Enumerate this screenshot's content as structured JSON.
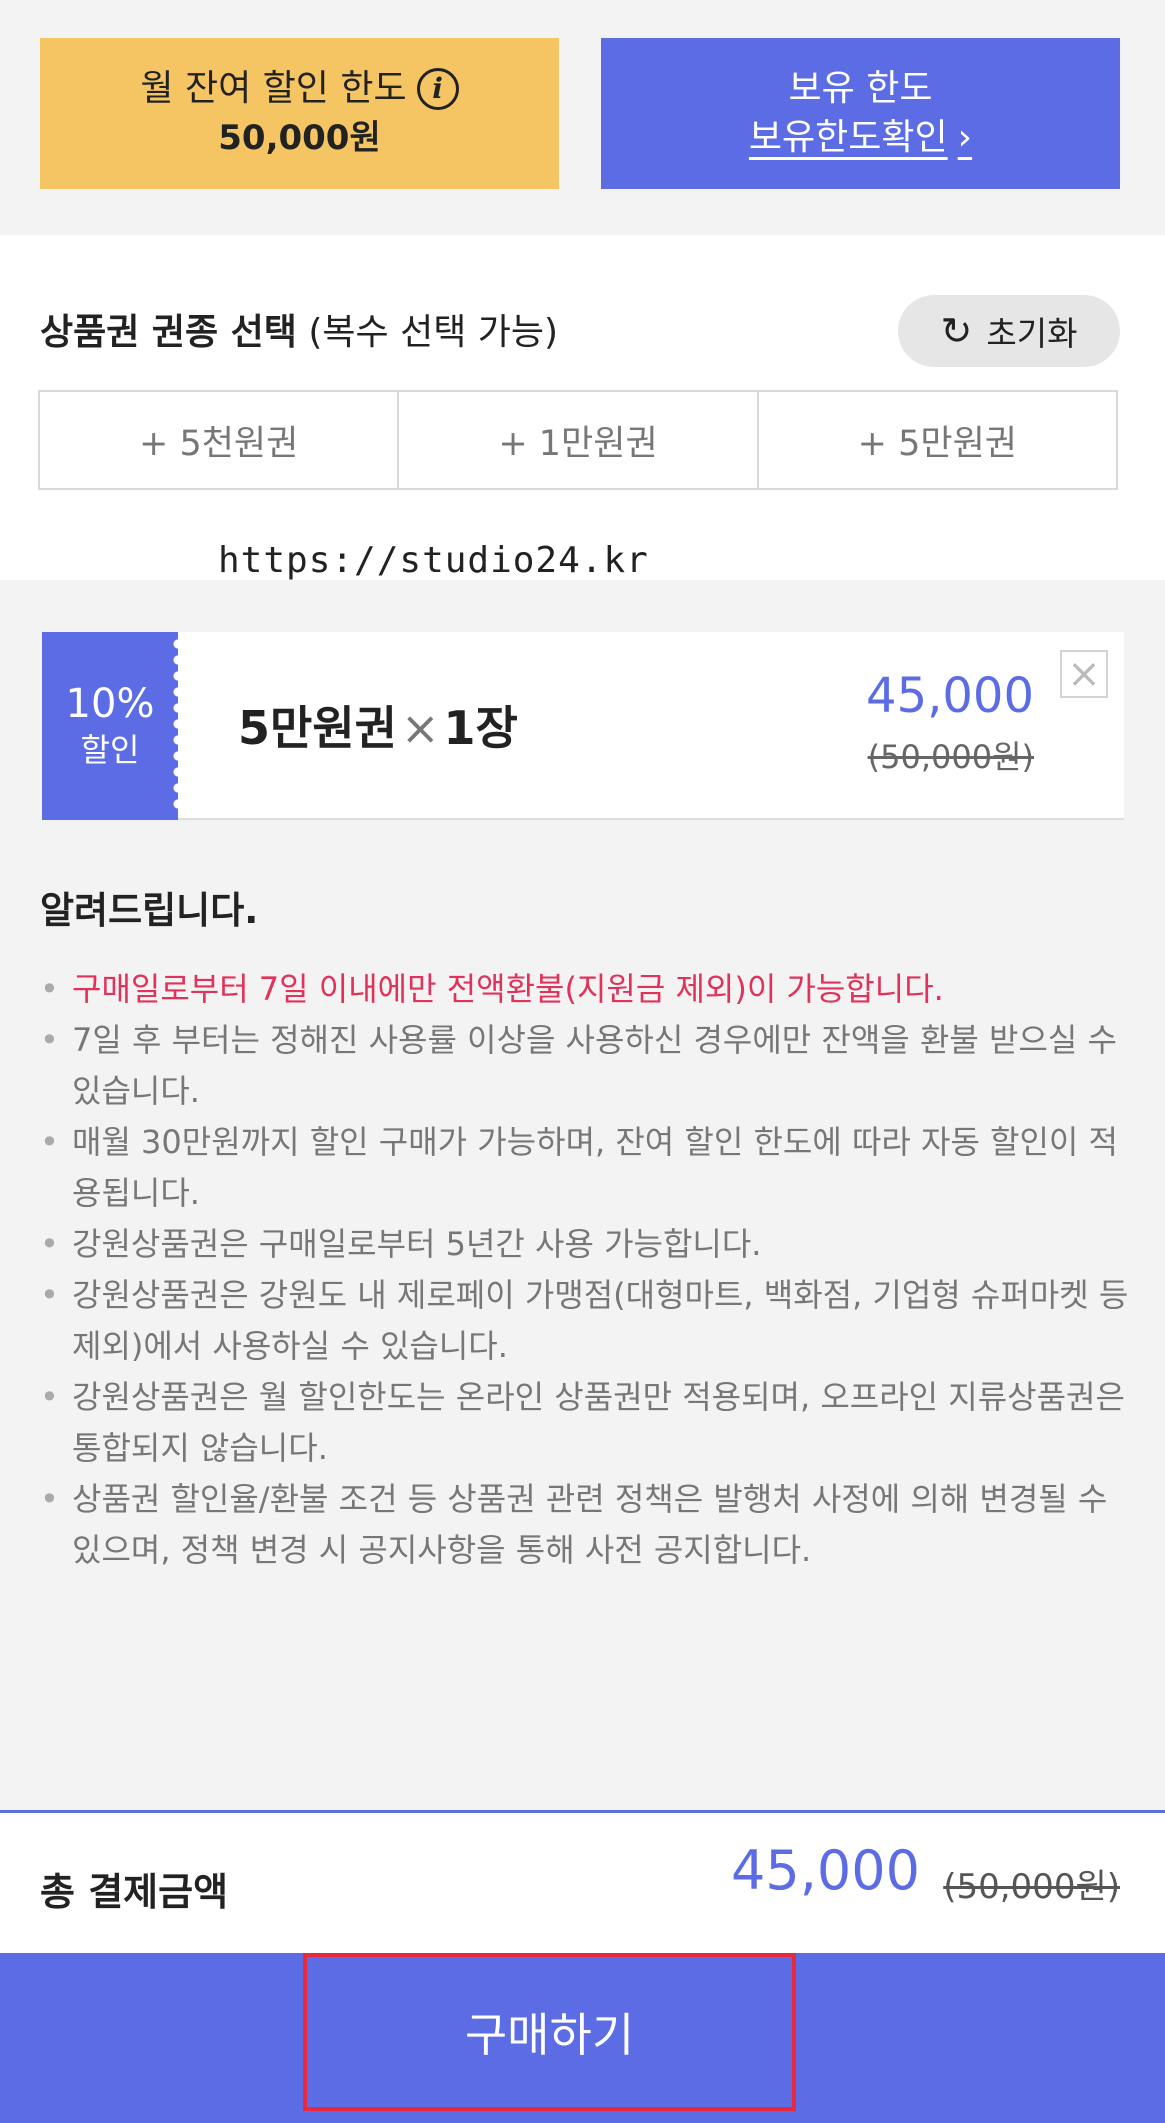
{
  "limits": {
    "monthly_title": "월 잔여 할인 한도",
    "monthly_value": "50,000원",
    "info_icon": "i",
    "owned_title": "보유 한도",
    "owned_link": "보유한도확인",
    "owned_link_arrow": "›"
  },
  "selection": {
    "title_bold": "상품권 권종 선택",
    "title_note": " (복수 선택 가능)",
    "reset_label": "초기화",
    "reset_icon": "↻",
    "denominations": [
      "+ 5천원권",
      "+ 1만원권",
      "+ 5만원권"
    ]
  },
  "watermark": "https://studio24.kr",
  "coupon": {
    "rate": "10%",
    "rate_label": "할인",
    "name": "5만원권",
    "times": "×",
    "quantity": "1장",
    "price": "45,000",
    "original_price": "(50,000원)",
    "close_icon": "×"
  },
  "notice": {
    "title": "알려드립니다.",
    "items": [
      "구매일로부터 7일 이내에만 전액환불(지원금 제외)이 가능합니다.",
      "7일 후 부터는 정해진 사용률 이상을 사용하신 경우에만 잔액을 환불 받으실 수 있습니다.",
      "매월 30만원까지 할인 구매가 가능하며, 잔여 할인 한도에 따라 자동 할인이 적용됩니다.",
      "강원상품권은 구매일로부터 5년간 사용 가능합니다.",
      "강원상품권은 강원도 내 제로페이 가맹점(대형마트, 백화점, 기업형 슈퍼마켓 등 제외)에서 사용하실 수 있습니다.",
      "강원상품권은 월 할인한도는 온라인 상품권만 적용되며, 오프라인 지류상품권은 통합되지 않습니다.",
      "상품권 할인율/환불 조건 등 상품권 관련 정책은 발행처 사정에 의해 변경될 수 있으며, 정책 변경 시 공지사항을 통해 사전 공지합니다."
    ]
  },
  "total": {
    "label": "총 결제금액",
    "price": "45,000",
    "original_price": "(50,000원)"
  },
  "purchase": {
    "label": "구매하기"
  },
  "colors": {
    "accent": "#5c6ce4",
    "monthly_box": "#f5c564",
    "alert_text": "#e0325a",
    "highlight_border": "#e8283c"
  }
}
